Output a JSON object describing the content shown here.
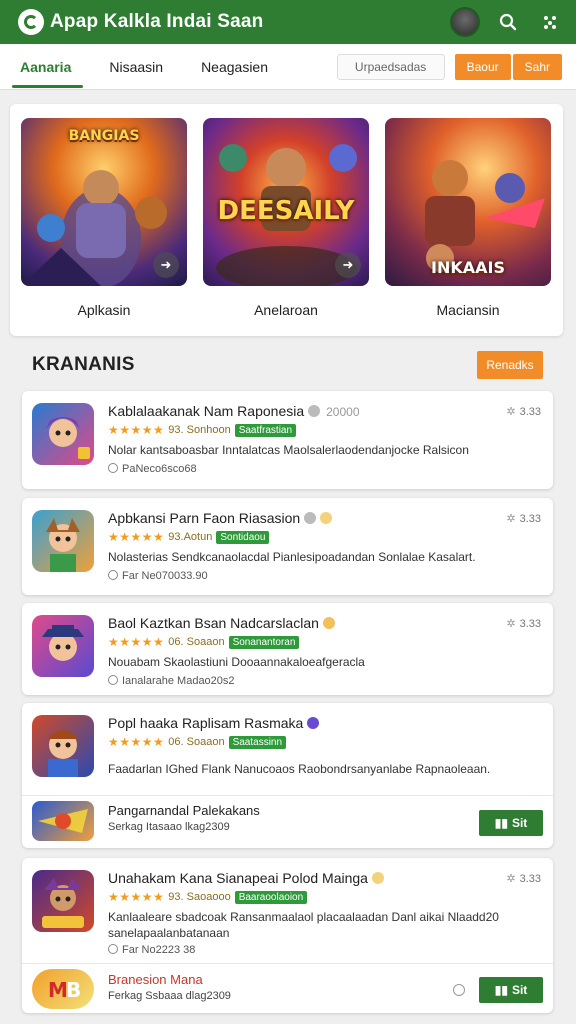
{
  "header": {
    "title": "Apap Kalkla Indai Saan",
    "icons": [
      "logo-icon",
      "avatar",
      "search-icon",
      "more-icon"
    ]
  },
  "tabs": [
    {
      "label": "Aanaria",
      "active": true
    },
    {
      "label": "Nisaasin",
      "active": false
    },
    {
      "label": "Neagasien",
      "active": false
    }
  ],
  "toolbar": {
    "search_value": "Urpaedsadas",
    "btn1": "Baour",
    "btn2": "Sahr"
  },
  "featured": [
    {
      "label": "Aplkasin",
      "art_text": "BANGIAS"
    },
    {
      "label": "Anelaroan",
      "art_text": "DEESAILY"
    },
    {
      "label": "Maciansin",
      "art_text": "INKAAIS"
    }
  ],
  "section": {
    "title": "KRANANIS",
    "button": "Renadks"
  },
  "apps": [
    {
      "title": "Kablalaakanak Nam Raponesia",
      "meta": "20000",
      "stars": "★★★★★",
      "rating": "93. Sonhoon",
      "tag": "Saatfrastian",
      "desc": "Nolar kantsaboasbar Inntalatcas Maolsalerlaodendanjocke Ralsicon",
      "sub": "PaNeco6sco68",
      "right": "3.33"
    },
    {
      "title": "Apbkansi Parn Faon Riasasion",
      "meta": "",
      "stars": "★★★★★",
      "rating": "93.Aotun",
      "tag": "Sontidaou",
      "desc": "Nolasterias Sendkcanaolacdal Pianlesipoadandan Sonlalae Kasalart.",
      "sub": "Far Ne070033.90",
      "right": "3.33"
    },
    {
      "title": "Baol Kaztkan Bsan Nadcarslaclan",
      "meta": "",
      "stars": "★★★★★",
      "rating": "06. Soaaon",
      "tag": "Sonanantoran",
      "desc": "Nouabam Skaolastiuni Dooaannakaloeafgeracla",
      "sub": "Ianalarahe Madao20s2",
      "right": "3.33"
    },
    {
      "title": "Popl haaka Raplisam Rasmaka",
      "meta": "",
      "stars": "★★★★★",
      "rating": "06. Soaaon",
      "tag": "Saatassinn",
      "desc": "Faadarlan IGhed Flank Nanucoaos Raobondrsanyanlabe Rapnaoleaan.",
      "sub": "",
      "right": ""
    },
    {
      "title": "Unahakam Kana Sianapeai Polod Mainga",
      "meta": "",
      "stars": "★★★★★",
      "rating": "93. Saoaooo",
      "tag": "Baaraoolaoion",
      "desc": "Kanlaaleare sbadcoak Ransanmaalaol placaalaadan Danl aikai Nlaadd20",
      "desc2": "sanelapaalanbatanaan",
      "sub": "Far No2223 38",
      "right": "3.33"
    }
  ],
  "sub_rows": [
    {
      "title": "Pangarnandal Palekakans",
      "sub": "Serkag Itasaao lkag2309",
      "button": "Sit"
    },
    {
      "title": "Branesion Mana",
      "sub": "Ferkag Ssbaaa dlag2309",
      "button": "Sit"
    }
  ]
}
